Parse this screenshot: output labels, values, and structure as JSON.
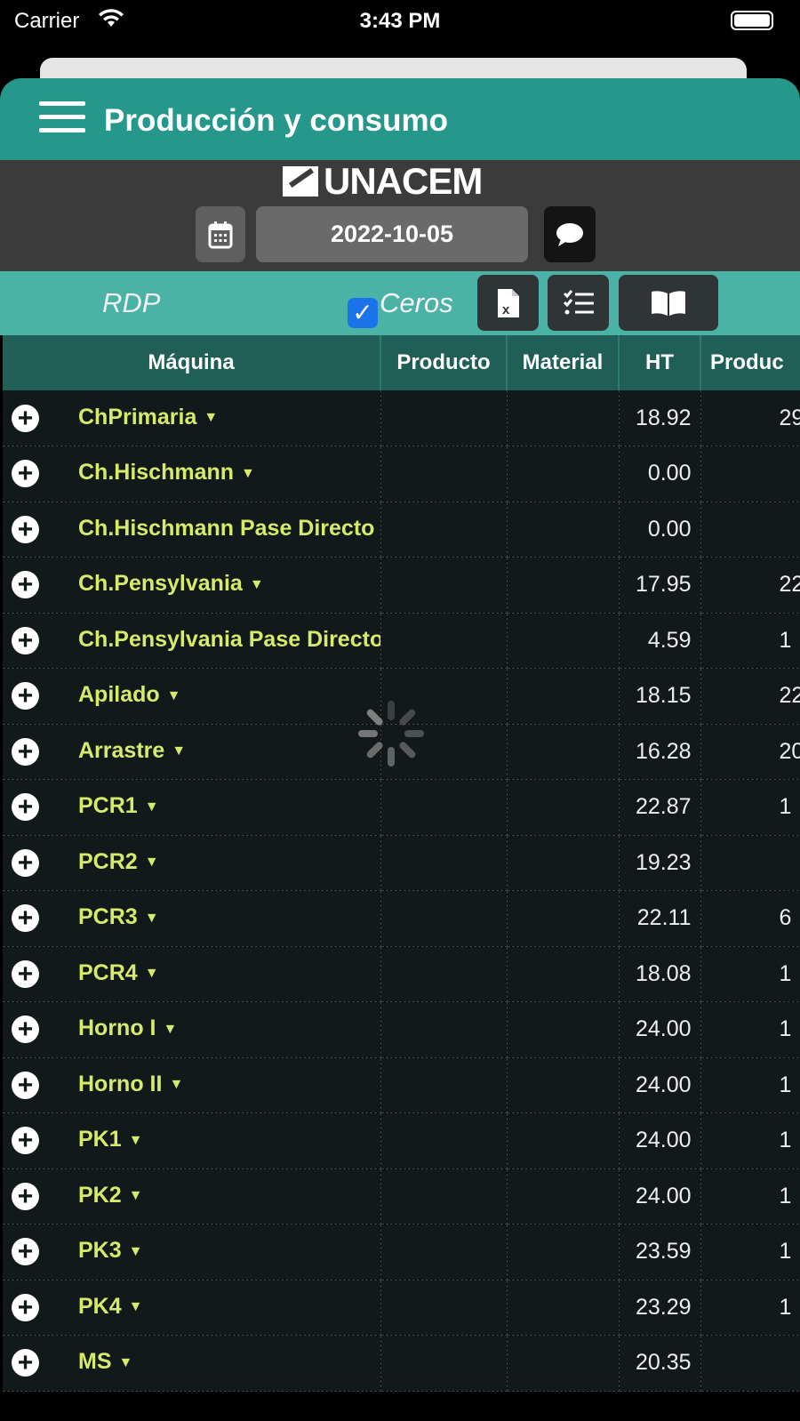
{
  "status": {
    "carrier": "Carrier",
    "time": "3:43 PM"
  },
  "header": {
    "title": "Producción y consumo"
  },
  "brand": {
    "logo": "UNACEM"
  },
  "date": {
    "value": "2022-10-05"
  },
  "toolbar": {
    "rdp": "RDP",
    "ceros_label": "Ceros",
    "ceros_checked": true
  },
  "table": {
    "columns": [
      "Máquina",
      "Producto",
      "Material",
      "HT",
      "Produc"
    ],
    "rows": [
      {
        "maquina": "ChPrimaria",
        "ht": "18.92",
        "prod": "29"
      },
      {
        "maquina": "Ch.Hischmann",
        "ht": "0.00",
        "prod": ""
      },
      {
        "maquina": "Ch.Hischmann Pase Directo",
        "ht": "0.00",
        "prod": ""
      },
      {
        "maquina": "Ch.Pensylvania",
        "ht": "17.95",
        "prod": "22"
      },
      {
        "maquina": "Ch.Pensylvania Pase Directo",
        "ht": "4.59",
        "prod": "1"
      },
      {
        "maquina": "Apilado",
        "ht": "18.15",
        "prod": "22"
      },
      {
        "maquina": "Arrastre",
        "ht": "16.28",
        "prod": "20"
      },
      {
        "maquina": "PCR1",
        "ht": "22.87",
        "prod": "1"
      },
      {
        "maquina": "PCR2",
        "ht": "19.23",
        "prod": ""
      },
      {
        "maquina": "PCR3",
        "ht": "22.11",
        "prod": "6"
      },
      {
        "maquina": "PCR4",
        "ht": "18.08",
        "prod": "1"
      },
      {
        "maquina": "Horno I",
        "ht": "24.00",
        "prod": "1"
      },
      {
        "maquina": "Horno II",
        "ht": "24.00",
        "prod": "1"
      },
      {
        "maquina": "PK1",
        "ht": "24.00",
        "prod": "1"
      },
      {
        "maquina": "PK2",
        "ht": "24.00",
        "prod": "1"
      },
      {
        "maquina": "PK3",
        "ht": "23.59",
        "prod": "1"
      },
      {
        "maquina": "PK4",
        "ht": "23.29",
        "prod": "1"
      },
      {
        "maquina": "MS",
        "ht": "20.35",
        "prod": ""
      }
    ]
  }
}
